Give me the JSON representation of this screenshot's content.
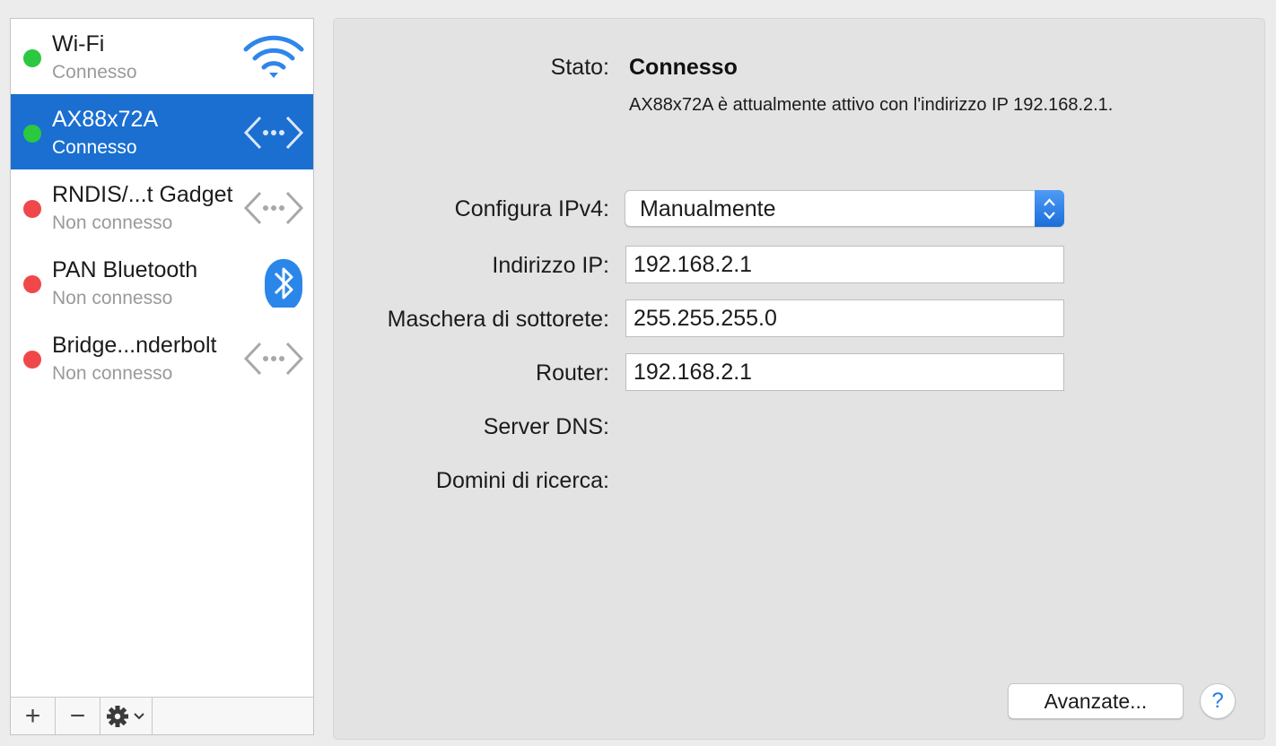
{
  "colors": {
    "selected_row": "#1a6fd1",
    "status_connected": "#2bc840",
    "status_disconnected": "#f0484a",
    "accent_blue": "#2a7ae2"
  },
  "sidebar": {
    "services": [
      {
        "name": "Wi-Fi",
        "status": "Connesso",
        "state": "connected",
        "icon": "wifi-icon",
        "selected": false
      },
      {
        "name": "AX88x72A",
        "status": "Connesso",
        "state": "connected",
        "icon": "ethernet-icon",
        "selected": true
      },
      {
        "name": "RNDIS/...t Gadget",
        "status": "Non connesso",
        "state": "disconnected",
        "icon": "ethernet-icon",
        "selected": false
      },
      {
        "name": "PAN Bluetooth",
        "status": "Non connesso",
        "state": "disconnected",
        "icon": "bluetooth-icon",
        "selected": false
      },
      {
        "name": "Bridge...nderbolt",
        "status": "Non connesso",
        "state": "disconnected",
        "icon": "ethernet-icon",
        "selected": false
      }
    ],
    "toolbar": {
      "add": "+",
      "remove": "−",
      "gear": "⚙⌄"
    }
  },
  "detail": {
    "status_label": "Stato:",
    "status_value": "Connesso",
    "status_description": "AX88x72A è attualmente attivo con l'indirizzo IP 192.168.2.1.",
    "configure_label": "Configura IPv4:",
    "configure_value": "Manualmente",
    "ip_label": "Indirizzo IP:",
    "ip_value": "192.168.2.1",
    "subnet_label": "Maschera di sottorete:",
    "subnet_value": "255.255.255.0",
    "router_label": "Router:",
    "router_value": "192.168.2.1",
    "dns_label": "Server DNS:",
    "search_domains_label": "Domini di ricerca:",
    "advanced_button": "Avanzate...",
    "help_button": "?"
  }
}
